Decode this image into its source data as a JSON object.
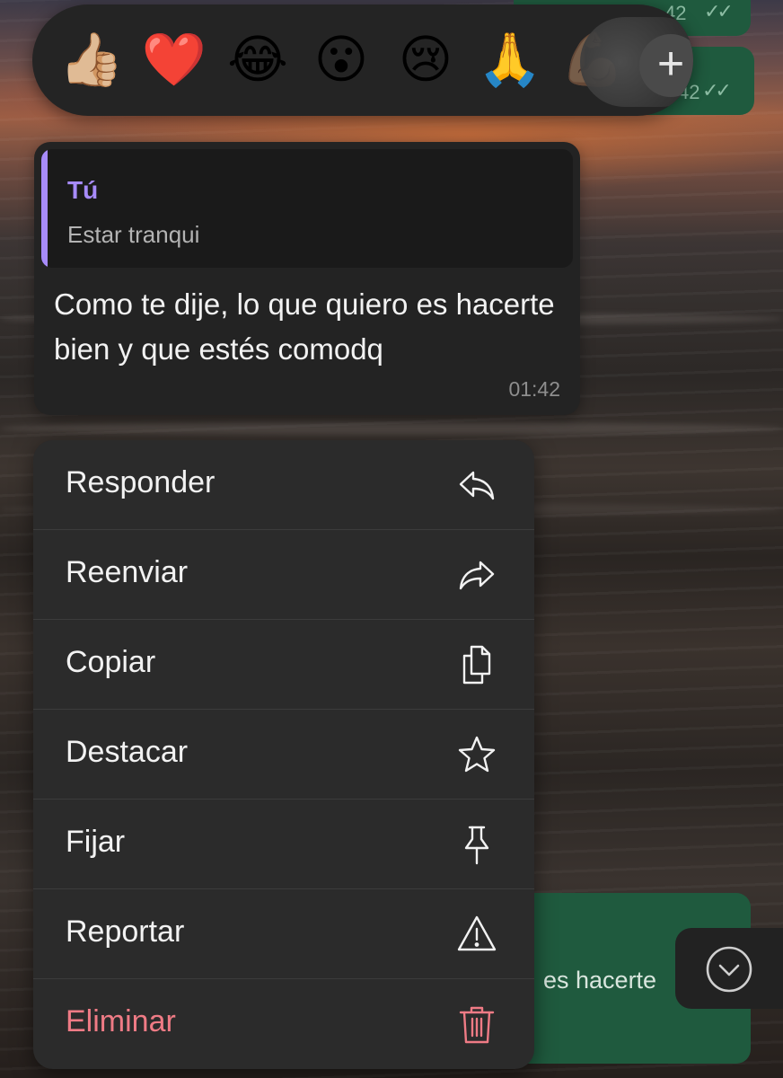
{
  "reactions": {
    "items": [
      {
        "emoji": "👍🏼",
        "name": "thumbs-up"
      },
      {
        "emoji": "❤️",
        "name": "red-heart"
      },
      {
        "emoji": "😂",
        "name": "tears-of-joy"
      },
      {
        "emoji": "😮",
        "name": "open-mouth"
      },
      {
        "emoji": "😢",
        "name": "crying-face"
      },
      {
        "emoji": "🙏",
        "name": "folded-hands"
      },
      {
        "emoji": "💪🏽",
        "name": "flexed-biceps"
      }
    ],
    "more_label": "+"
  },
  "message": {
    "quote_author": "Tú",
    "quote_text": "Estar tranqui",
    "text": "Como te dije, lo que quiero es hacerte bien y que estés comodq",
    "time": "01:42"
  },
  "menu": {
    "items": [
      {
        "label": "Responder",
        "icon": "reply-icon"
      },
      {
        "label": "Reenviar",
        "icon": "forward-icon"
      },
      {
        "label": "Copiar",
        "icon": "copy-icon"
      },
      {
        "label": "Destacar",
        "icon": "star-icon"
      },
      {
        "label": "Fijar",
        "icon": "pin-icon"
      },
      {
        "label": "Reportar",
        "icon": "warning-icon"
      },
      {
        "label": "Eliminar",
        "icon": "trash-icon",
        "color": "#ef7b85"
      }
    ]
  },
  "background_chat": {
    "partial_text": "es hacerte",
    "partial_time_1": "42",
    "partial_time_2": "42"
  },
  "colors": {
    "accent_quote": "#a78bfa",
    "danger": "#ef7b85",
    "outgoing_bubble": "#1f5a3e"
  }
}
